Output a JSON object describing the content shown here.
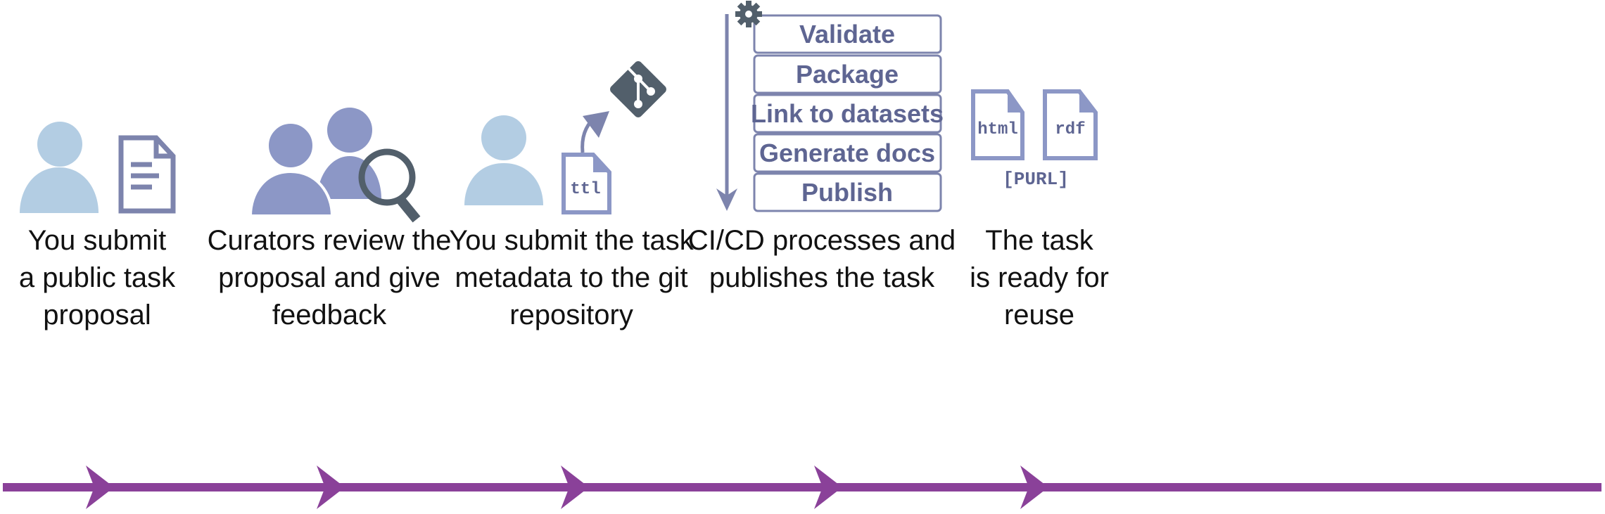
{
  "colors": {
    "submitter": "#b3cde3",
    "curator": "#8c97c6",
    "document_outline": "#7d84ad",
    "dark_icon": "#525f6b",
    "timeline": "#8a4199",
    "box_text": "#5e6592"
  },
  "steps": [
    {
      "icon": "person-with-document-icon",
      "caption": [
        "You submit",
        "a public task",
        "proposal"
      ]
    },
    {
      "icon": "curators-with-magnifier-icon",
      "caption": [
        "Curators review the",
        "proposal and give",
        "feedback"
      ]
    },
    {
      "icon": "person-with-ttl-file-to-git-icon",
      "file_label": "ttl",
      "caption": [
        "You submit the task",
        "metadata to the git",
        "repository"
      ]
    },
    {
      "icon": "gear-pipeline-icon",
      "pipeline": [
        "Validate",
        "Package",
        "Link to datasets",
        "Generate docs",
        "Publish"
      ],
      "caption": [
        "CI/CD processes and",
        "publishes the task"
      ]
    },
    {
      "icon": "output-files-icon",
      "files": [
        "html",
        "rdf"
      ],
      "purl_label": "[PURL]",
      "caption": [
        "The task",
        "is ready for",
        "reuse"
      ]
    }
  ]
}
